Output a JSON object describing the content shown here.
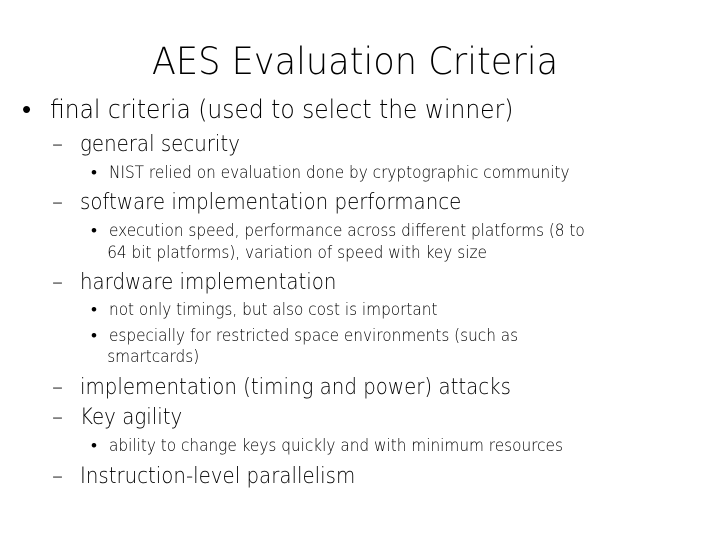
{
  "slide": {
    "title": "AES Evaluation Criteria",
    "bullet": {
      "marker": "•",
      "text": "final criteria (used to select the winner)"
    },
    "criteria": [
      {
        "marker": "–",
        "text": "general security",
        "details": [
          {
            "marker": "•",
            "lines": [
              "NIST relied on evaluation done by cryptographic community"
            ]
          }
        ]
      },
      {
        "marker": "–",
        "text": "software implementation performance",
        "details": [
          {
            "marker": "•",
            "lines": [
              "execution speed, performance across different platforms (8 to",
              "64 bit platforms), variation of speed with key size"
            ]
          }
        ]
      },
      {
        "marker": "–",
        "text": "hardware implementation",
        "details": [
          {
            "marker": "•",
            "lines": [
              "not only timings, but also cost is important"
            ]
          },
          {
            "marker": "•",
            "lines": [
              "especially for restricted space environments (such as",
              "smartcards)"
            ]
          }
        ]
      },
      {
        "marker": "–",
        "text": "implementation (timing and power) attacks",
        "details": []
      },
      {
        "marker": "–",
        "text": "Key agility",
        "details": [
          {
            "marker": "•",
            "lines": [
              "ability to change keys quickly and with minimum resources"
            ]
          }
        ]
      },
      {
        "marker": "–",
        "text": "Instruction-level parallelism",
        "details": []
      }
    ]
  }
}
